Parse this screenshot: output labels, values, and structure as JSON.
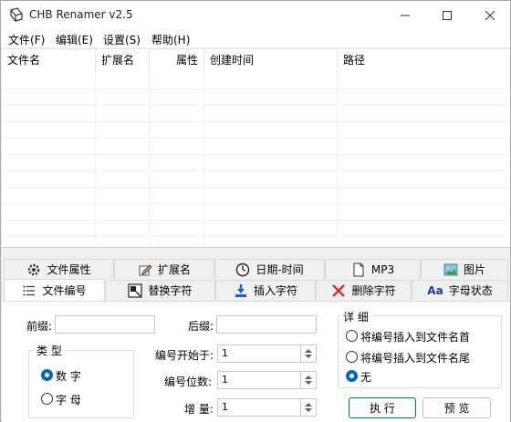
{
  "window": {
    "title": "CHB Renamer v2.5"
  },
  "menu": [
    "文件(F)",
    "编辑(E)",
    "设置(S)",
    "帮助(H)"
  ],
  "list": {
    "columns": [
      "文件名",
      "扩展名",
      "属性",
      "创建时间",
      "路径"
    ]
  },
  "tabs": {
    "row1": [
      {
        "label": "文件属性",
        "icon": "gear-icon"
      },
      {
        "label": "扩展名",
        "icon": "edit-icon"
      },
      {
        "label": "日期-时间",
        "icon": "clock-icon"
      },
      {
        "label": "MP3",
        "icon": "document-icon"
      },
      {
        "label": "图片",
        "icon": "picture-icon"
      }
    ],
    "row2": [
      {
        "label": "文件编号",
        "icon": "numbered-list-icon",
        "active": true
      },
      {
        "label": "替换字符",
        "icon": "replace-icon"
      },
      {
        "label": "插入字符",
        "icon": "insert-icon"
      },
      {
        "label": "删除字符",
        "icon": "delete-icon"
      },
      {
        "label": "字母状态",
        "icon": "case-icon",
        "glyph": "Aa"
      }
    ]
  },
  "numbering": {
    "prefix_label": "前缀:",
    "prefix_value": "",
    "suffix_label": "后缀:",
    "suffix_value": "",
    "type_group": "类 型",
    "type_options": [
      "数 字",
      "字 母"
    ],
    "type_selected": 0,
    "start_label": "编号开始于:",
    "start_value": "1",
    "digits_label": "编号位数:",
    "digits_value": "1",
    "increment_label": "增 量:",
    "increment_value": "1",
    "detail_group": "详 细",
    "detail_options": [
      "将编号插入到文件名首",
      "将编号插入到文件名尾",
      "无"
    ],
    "detail_selected": 2,
    "execute_button": "执 行",
    "preview_button": "预 览"
  },
  "colors": {
    "accent": "#0067c0",
    "close_x": "#d42020"
  }
}
